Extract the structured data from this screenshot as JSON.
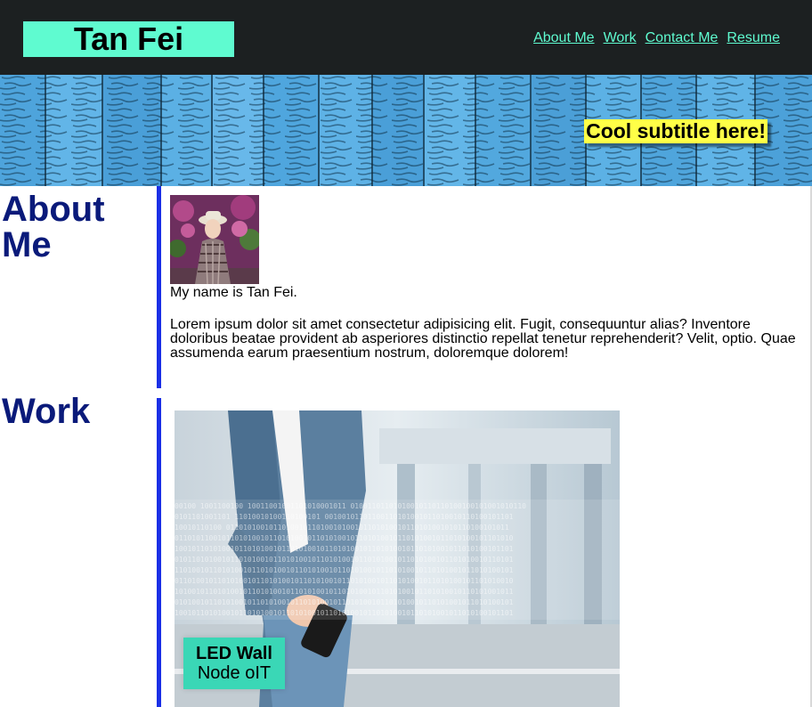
{
  "header": {
    "brand": "Tan Fei",
    "nav": [
      {
        "label": "About Me"
      },
      {
        "label": "Work"
      },
      {
        "label": "Contact Me"
      },
      {
        "label": "Resume"
      }
    ],
    "colors": {
      "background": "#1c2021",
      "accent": "#5ffbd0"
    }
  },
  "hero": {
    "subtitle": "Cool subtitle here!",
    "subtitle_bg": "#ffff47"
  },
  "about": {
    "title": "About Me",
    "intro": "My name is Tan Fei.",
    "body": "Lorem ipsum dolor sit amet consectetur adipisicing elit. Fugit, consequuntur alias? Inventore doloribus beatae provident ab asperiores distinctio repellat tenetur reprehenderit? Velit, optio. Quae assumenda earum praesentium nostrum, doloremque dolorem!",
    "title_color": "#0a1a7a"
  },
  "work": {
    "title": "Work",
    "projects": [
      {
        "name": "LED Wall",
        "subtitle": "Node oIT"
      }
    ]
  },
  "colors": {
    "rule": "#1a2fe6",
    "label_bg": "#3ad7b6"
  }
}
